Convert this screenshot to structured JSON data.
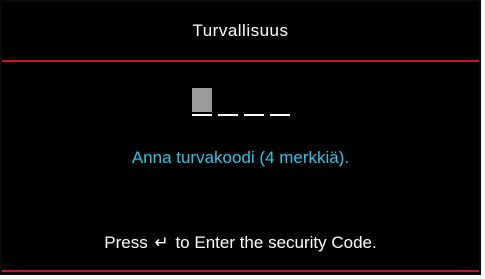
{
  "dialog": {
    "title": "Turvallisuus",
    "code_slots": 4,
    "active_slot": 0,
    "instruction": "Anna turvakoodi (4 merkkiä).",
    "footer": {
      "before": "Press",
      "enter_icon": "enter-key-icon",
      "enter_glyph": "↵",
      "after": "to Enter the security Code."
    }
  },
  "colors": {
    "background": "#000000",
    "divider": "#c8102e",
    "instruction_text": "#2ec4e8",
    "text": "#ffffff",
    "active_slot": "#9a9a9a"
  }
}
